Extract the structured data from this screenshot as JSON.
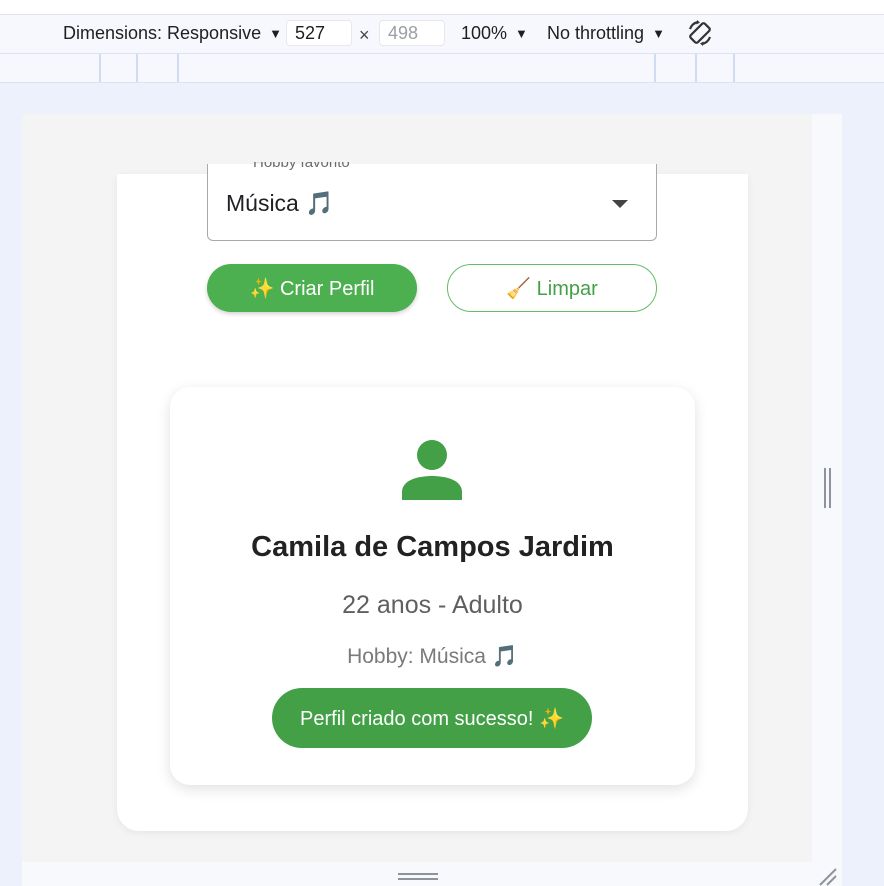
{
  "devtools": {
    "dimensions_label": "Dimensions: Responsive",
    "width_value": "527",
    "height_placeholder": "498",
    "times_symbol": "×",
    "zoom_label": "100%",
    "throttling_label": "No throttling",
    "rotate_icon": "rotate-icon"
  },
  "form": {
    "hobby_label": "Hobby favorito",
    "hobby_value": "Música 🎵"
  },
  "buttons": {
    "create": "✨ Criar Perfil",
    "clear": "🧹 Limpar"
  },
  "profile": {
    "name": "Camila de Campos Jardim",
    "age_line": "22 anos - Adulto",
    "hobby_line": "Hobby: Música 🎵",
    "success_message": "Perfil criado com sucesso! ✨"
  },
  "colors": {
    "primary_green": "#4caf50",
    "dark_green": "#43a047",
    "avatar_green": "#43a047"
  }
}
